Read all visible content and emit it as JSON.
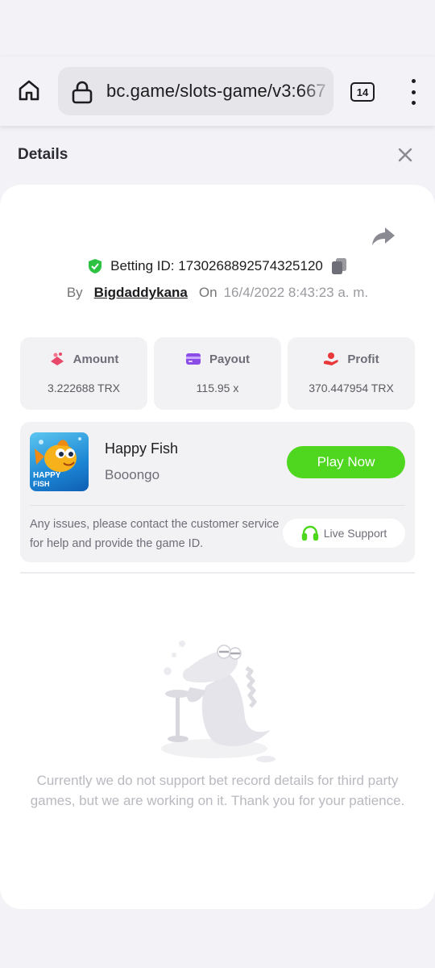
{
  "browser": {
    "url": "bc.game/slots-game/v3:667",
    "tab_count": "14"
  },
  "panel": {
    "title": "Details"
  },
  "bet": {
    "betting_id_label": "Betting ID:",
    "betting_id": "1730268892574325120",
    "by_label": "By",
    "username": "Bigdaddykana",
    "on_label": "On",
    "date": "16/4/2022 8:43:23 a. m."
  },
  "stats": [
    {
      "label": "Amount",
      "value": "3.222688 TRX"
    },
    {
      "label": "Payout",
      "value": "115.95 x"
    },
    {
      "label": "Profit",
      "value": "370.447954 TRX"
    }
  ],
  "game": {
    "name": "Happy Fish",
    "provider": "Booongo",
    "thumb_text_line1": "HAPPY",
    "thumb_text_line2": "FISH",
    "play_label": "Play Now",
    "issue_text": "Any issues, please contact the customer service for help and provide the game ID.",
    "support_label": "Live Support"
  },
  "empty_state": {
    "message": "Currently we do not support bet record details for third party games, but we are working on it. Thank you for your patience."
  },
  "colors": {
    "accent_green": "#4ed71e",
    "shield_green": "#2ec243",
    "amount_icon": "#e8496a",
    "payout_icon": "#8a4de8",
    "profit_icon": "#e8383a"
  }
}
